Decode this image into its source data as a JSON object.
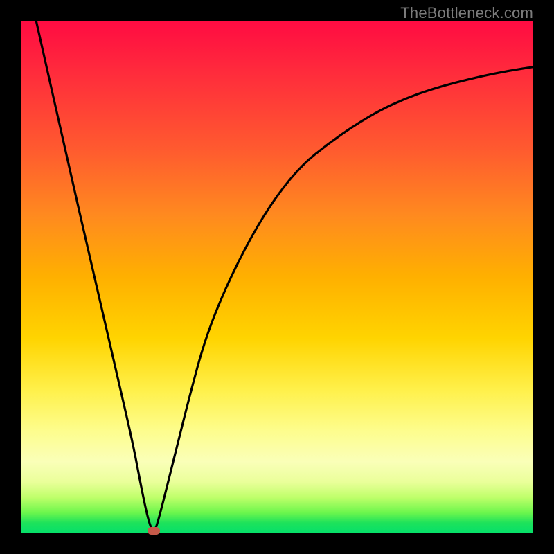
{
  "watermark": "TheBottleneck.com",
  "colors": {
    "frame": "#000000",
    "watermark_text": "#7c7c7c",
    "curve_stroke": "#000000",
    "marker": "#c65a4a",
    "gradient_stops": [
      "#ff0b42",
      "#ff2b3c",
      "#ff5a2f",
      "#ff8a1f",
      "#ffb000",
      "#ffd400",
      "#fff04a",
      "#fdfd8d",
      "#faffb8",
      "#eaff9a",
      "#bfff6a",
      "#6cf64d",
      "#1de25b",
      "#05e06a"
    ]
  },
  "chart_data": {
    "type": "line",
    "title": "",
    "xlabel": "",
    "ylabel": "",
    "xlim": [
      0,
      100
    ],
    "ylim": [
      0,
      100
    ],
    "x": [
      3,
      5,
      8,
      10,
      13,
      16,
      19,
      22,
      23.5,
      25,
      26,
      27,
      30,
      33,
      36,
      40,
      45,
      50,
      55,
      60,
      65,
      70,
      75,
      80,
      85,
      90,
      95,
      100
    ],
    "y": [
      100,
      91,
      78,
      69,
      56,
      43,
      30,
      17,
      9,
      2,
      0,
      3,
      15,
      27,
      38,
      48,
      58,
      66,
      72,
      76,
      79.5,
      82.5,
      84.8,
      86.6,
      88,
      89.2,
      90.2,
      91
    ],
    "curve_minimum": {
      "x": 26,
      "y": 0
    },
    "marker": {
      "x": 26,
      "y": 0.5
    },
    "notes": "Axes are unlabeled in the source image; x and y normalized to 0–100. y=0 at bottom (green), y=100 at top (red)."
  }
}
